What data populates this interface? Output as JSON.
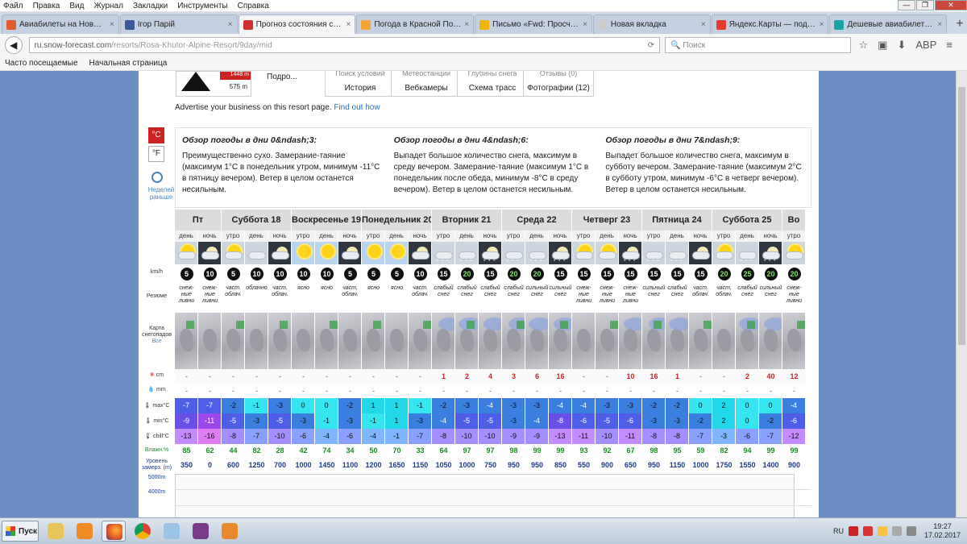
{
  "menubar": {
    "items": [
      "Файл",
      "Правка",
      "Вид",
      "Журнал",
      "Закладки",
      "Инструменты",
      "Справка"
    ]
  },
  "window_controls": {
    "minimize": "—",
    "maximize": "❐",
    "close": "✕"
  },
  "tabs": [
    {
      "label": "Авиабилеты на Новый 2...",
      "color": "#e35d2c",
      "active": false
    },
    {
      "label": "Ігор Парій",
      "color": "#3b5998",
      "active": false
    },
    {
      "label": "Прогноз состояния снег...",
      "color": "#d32f2f",
      "active": true
    },
    {
      "label": "Погода в Красной Поля...",
      "color": "#f4a433",
      "active": false
    },
    {
      "label": "Письмо «Fwd: Просчет п...",
      "color": "#f2b400",
      "active": false
    },
    {
      "label": "Новая вкладка",
      "color": "#cccccc",
      "active": false
    },
    {
      "label": "Яндекс.Карты — подро...",
      "color": "#e43b2c",
      "active": false
    },
    {
      "label": "Дешевые авиабилеты М...",
      "color": "#1aa3a3",
      "active": false
    }
  ],
  "tab_close": "×",
  "new_tab": "+",
  "navbar": {
    "url_host": "ru.snow-forecast.com",
    "url_path": "/resorts/Rosa-Khutor-Alpine-Resort/9day/mid",
    "reload": "⟳",
    "search_placeholder": "Поиск",
    "back": "◀",
    "icons": [
      "☆",
      "▣",
      "⬇",
      "ABP",
      "≡"
    ]
  },
  "bookmarks": [
    "Часто посещаемые",
    "Начальная страница"
  ],
  "resort": {
    "top_alt": "1448 m",
    "bottom_alt": "575 m",
    "more_link": "Подро...",
    "buttons": [
      {
        "label": "Поиск условий",
        "sub": "История"
      },
      {
        "label": "Метеостанции",
        "sub": "Вебкамеры"
      },
      {
        "label": "Глубины снега",
        "sub": "Схема трасс"
      },
      {
        "label": "Отзывы (0)",
        "sub": "Фотографии (12)"
      }
    ],
    "advert_text": "Advertise your business on this resort page.",
    "advert_link": "Find out how"
  },
  "units": {
    "c": "°C",
    "f": "°F",
    "prev_link": "Неделей раньше"
  },
  "overview": [
    {
      "title": "Обзор погоды в дни 0&ndash;3:",
      "text": "Преимущественно сухо. Замерание-таяние (максимум 1°C в понедельник утром, минимум -11°C в пятницу вечером). Ветер в целом останется несильным."
    },
    {
      "title": "Обзор погоды в дни 4&ndash;6:",
      "text": "Выпадет большое количество снега, максимум в среду вечером. Замерание-таяние (максимум 1°C в понедельник после обеда, минимум -8°C в среду вечером). Ветер в целом останется несильным."
    },
    {
      "title": "Обзор погоды в дни 7&ndash;9:",
      "text": "Выпадет большое количество снега, максимум в субботу вечером. Замерание-таяние (максимум 2°C в субботу утром, минимум -6°C в четверг вечером). Ветер в целом останется несильным."
    }
  ],
  "row_labels": {
    "wind": "km/h",
    "summary": "Резюме",
    "map": "Карта снегопадов",
    "map_link": "Все",
    "snow": "cm",
    "rain": "mm",
    "max": "max°C",
    "min": "min°C",
    "chill": "chill°C",
    "humid": "Влажн.%",
    "freeze": "Уровень замерз. (m)",
    "alt1": "5000m",
    "alt2": "4000m"
  },
  "days": [
    {
      "name": "Пт",
      "slots": 2
    },
    {
      "name": "Суббота 18",
      "slots": 3
    },
    {
      "name": "Воскресенье 19",
      "slots": 3
    },
    {
      "name": "Понедельник 20",
      "slots": 3
    },
    {
      "name": "Вторник 21",
      "slots": 3
    },
    {
      "name": "Среда 22",
      "slots": 3
    },
    {
      "name": "Четверг 23",
      "slots": 3
    },
    {
      "name": "Пятница 24",
      "slots": 3
    },
    {
      "name": "Суббота 25",
      "slots": 3
    },
    {
      "name": "Во",
      "slots": 1
    }
  ],
  "slots": [
    {
      "time": "день",
      "icon": "cloud-sun",
      "wind": "5",
      "summary": "снеж-ные ливни",
      "snow": "-",
      "rain": "-",
      "max": "-7",
      "min": "-9",
      "chill": "-13",
      "humid": "85",
      "freeze": "350"
    },
    {
      "time": "ночь",
      "icon": "night-moon",
      "wind": "10",
      "summary": "снеж-ные ливни",
      "snow": "-",
      "rain": "-",
      "max": "-7",
      "min": "-11",
      "chill": "-16",
      "humid": "62",
      "freeze": "0"
    },
    {
      "time": "утро",
      "icon": "cloud-sun",
      "wind": "5",
      "summary": "част. облач.",
      "snow": "-",
      "rain": "-",
      "max": "-2",
      "min": "-5",
      "chill": "-8",
      "humid": "44",
      "freeze": "600"
    },
    {
      "time": "день",
      "icon": "cloud",
      "wind": "10",
      "summary": "облачно",
      "snow": "-",
      "rain": "-",
      "max": "-1",
      "min": "-3",
      "chill": "-7",
      "humid": "82",
      "freeze": "1250"
    },
    {
      "time": "ночь",
      "icon": "night-moon",
      "wind": "10",
      "summary": "част. облач.",
      "snow": "-",
      "rain": "-",
      "max": "-3",
      "min": "-5",
      "chill": "-10",
      "humid": "28",
      "freeze": "700"
    },
    {
      "time": "утро",
      "icon": "sun",
      "wind": "10",
      "summary": "ясно",
      "snow": "-",
      "rain": "-",
      "max": "0",
      "min": "-3",
      "chill": "-6",
      "humid": "42",
      "freeze": "1000"
    },
    {
      "time": "день",
      "icon": "sun",
      "wind": "10",
      "summary": "ясно",
      "snow": "-",
      "rain": "-",
      "max": "0",
      "min": "-1",
      "chill": "-4",
      "humid": "74",
      "freeze": "1450"
    },
    {
      "time": "ночь",
      "icon": "night-moon",
      "wind": "5",
      "summary": "част. облач.",
      "snow": "-",
      "rain": "-",
      "max": "-2",
      "min": "-3",
      "chill": "-6",
      "humid": "34",
      "freeze": "1100"
    },
    {
      "time": "утро",
      "icon": "sun",
      "wind": "5",
      "summary": "ясно",
      "snow": "-",
      "rain": "-",
      "max": "1",
      "min": "-1",
      "chill": "-4",
      "humid": "50",
      "freeze": "1200"
    },
    {
      "time": "день",
      "icon": "sun",
      "wind": "5",
      "summary": "ясно",
      "snow": "-",
      "rain": "-",
      "max": "1",
      "min": "1",
      "chill": "-1",
      "humid": "70",
      "freeze": "1650"
    },
    {
      "time": "ночь",
      "icon": "night-moon",
      "wind": "10",
      "summary": "част. облач.",
      "snow": "-",
      "rain": "-",
      "max": "-1",
      "min": "-3",
      "chill": "-7",
      "humid": "33",
      "freeze": "1150"
    },
    {
      "time": "утро",
      "icon": "cloud-snow",
      "wind": "15",
      "summary": "слабый снег",
      "snow": "1",
      "rain": "-",
      "max": "-2",
      "min": "-4",
      "chill": "-8",
      "humid": "64",
      "freeze": "1050"
    },
    {
      "time": "день",
      "icon": "cloud-snow",
      "wind": "20",
      "summary": "слабый снег",
      "snow": "2",
      "rain": "-",
      "max": "-3",
      "min": "-5",
      "chill": "-10",
      "humid": "97",
      "freeze": "1000"
    },
    {
      "time": "ночь",
      "icon": "night-snow",
      "wind": "15",
      "summary": "слабый снег",
      "snow": "4",
      "rain": "-",
      "max": "-4",
      "min": "-5",
      "chill": "-10",
      "humid": "97",
      "freeze": "750"
    },
    {
      "time": "утро",
      "icon": "cloud-snow",
      "wind": "20",
      "summary": "слабый снег",
      "snow": "3",
      "rain": "-",
      "max": "-3",
      "min": "-3",
      "chill": "-9",
      "humid": "98",
      "freeze": "950"
    },
    {
      "time": "день",
      "icon": "cloud-snow",
      "wind": "20",
      "summary": "сильный снег",
      "snow": "6",
      "rain": "-",
      "max": "-3",
      "min": "-4",
      "chill": "-9",
      "humid": "99",
      "freeze": "950"
    },
    {
      "time": "ночь",
      "icon": "night-snow",
      "wind": "15",
      "summary": "сильный снег",
      "snow": "16",
      "rain": "-",
      "max": "-4",
      "min": "-8",
      "chill": "-13",
      "humid": "99",
      "freeze": "850"
    },
    {
      "time": "утро",
      "icon": "cloud-sun",
      "wind": "15",
      "summary": "снеж-ные ливни",
      "snow": "-",
      "rain": "-",
      "max": "-4",
      "min": "-6",
      "chill": "-11",
      "humid": "93",
      "freeze": "550"
    },
    {
      "time": "день",
      "icon": "cloud-sun",
      "wind": "15",
      "summary": "снеж-ные ливни",
      "snow": "-",
      "rain": "-",
      "max": "-3",
      "min": "-5",
      "chill": "-10",
      "humid": "92",
      "freeze": "900"
    },
    {
      "time": "ночь",
      "icon": "night-snow",
      "wind": "15",
      "summary": "снеж-ные ливни",
      "snow": "10",
      "rain": "-",
      "max": "-3",
      "min": "-6",
      "chill": "-11",
      "humid": "67",
      "freeze": "650"
    },
    {
      "time": "утро",
      "icon": "cloud-snow",
      "wind": "15",
      "summary": "сильный снег",
      "snow": "16",
      "rain": "-",
      "max": "-2",
      "min": "-3",
      "chill": "-8",
      "humid": "98",
      "freeze": "950"
    },
    {
      "time": "день",
      "icon": "cloud-snow",
      "wind": "15",
      "summary": "слабый снег",
      "snow": "1",
      "rain": "-",
      "max": "-2",
      "min": "-3",
      "chill": "-8",
      "humid": "95",
      "freeze": "1150"
    },
    {
      "time": "ночь",
      "icon": "night-moon",
      "wind": "15",
      "summary": "част. облач.",
      "snow": "-",
      "rain": "-",
      "max": "0",
      "min": "-2",
      "chill": "-7",
      "humid": "59",
      "freeze": "1000"
    },
    {
      "time": "утро",
      "icon": "cloud-sun",
      "wind": "20",
      "summary": "част. облач.",
      "snow": "-",
      "rain": "-",
      "max": "2",
      "min": "2",
      "chill": "-3",
      "humid": "82",
      "freeze": "1750"
    },
    {
      "time": "день",
      "icon": "cloud-snow",
      "wind": "25",
      "summary": "слабый снег",
      "snow": "2",
      "rain": "-",
      "max": "0",
      "min": "0",
      "chill": "-6",
      "humid": "94",
      "freeze": "1550"
    },
    {
      "time": "ночь",
      "icon": "night-snow",
      "wind": "20",
      "summary": "сильный снег",
      "snow": "40",
      "rain": "-",
      "max": "0",
      "min": "-2",
      "chill": "-7",
      "humid": "99",
      "freeze": "1400"
    },
    {
      "time": "утро",
      "icon": "cloud-sun",
      "wind": "20",
      "summary": "снеж-ные ливни",
      "snow": "12",
      "rain": "-",
      "max": "-4",
      "min": "-6",
      "chill": "-12",
      "humid": "99",
      "freeze": "900"
    }
  ],
  "taskbar": {
    "start": "Пуск",
    "lang": "RU",
    "time": "19:27",
    "date": "17.02.2017"
  }
}
